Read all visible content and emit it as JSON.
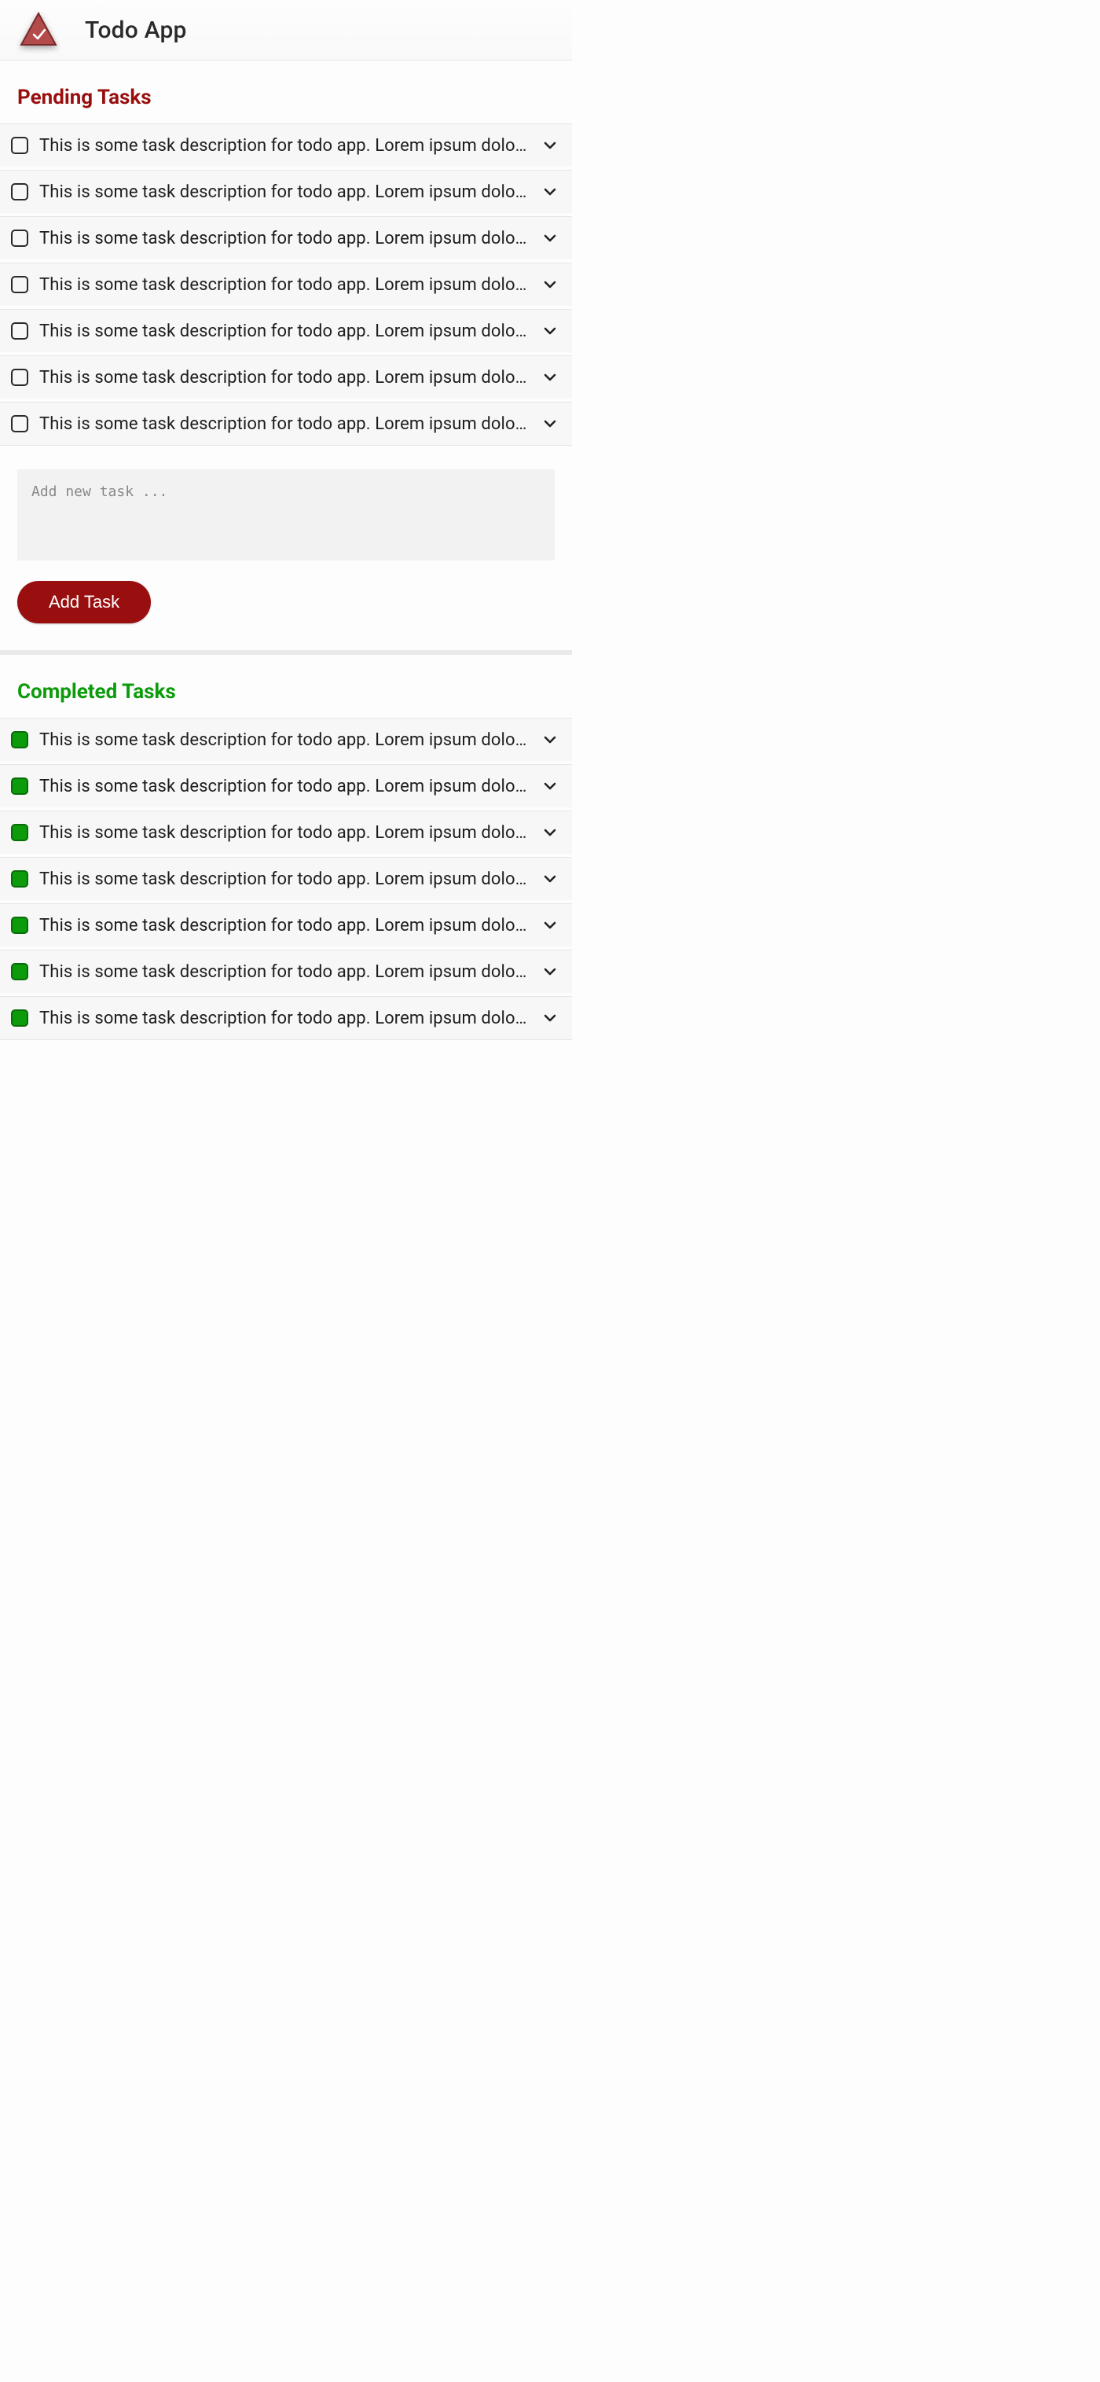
{
  "header": {
    "title": "Todo App",
    "logo_icon": "triangle-check-icon"
  },
  "pending": {
    "title": "Pending Tasks",
    "tasks": [
      {
        "text": "This is some task description for todo app. Lorem ipsum dolor sit amet."
      },
      {
        "text": "This is some task description for todo app. Lorem ipsum dolor sit amet."
      },
      {
        "text": "This is some task description for todo app. Lorem ipsum dolor sit amet."
      },
      {
        "text": "This is some task description for todo app. Lorem ipsum dolor sit amet."
      },
      {
        "text": "This is some task description for todo app. Lorem ipsum dolor sit amet."
      },
      {
        "text": "This is some task description for todo app. Lorem ipsum dolor sit amet."
      },
      {
        "text": "This is some task description for todo app. Lorem ipsum dolor sit amet."
      }
    ]
  },
  "add": {
    "placeholder": "Add new task ...",
    "button_label": "Add Task"
  },
  "completed": {
    "title": "Completed Tasks",
    "tasks": [
      {
        "text": "This is some task description for todo app. Lorem ipsum dolor sit amet."
      },
      {
        "text": "This is some task description for todo app. Lorem ipsum dolor sit amet."
      },
      {
        "text": "This is some task description for todo app. Lorem ipsum dolor sit amet."
      },
      {
        "text": "This is some task description for todo app. Lorem ipsum dolor sit amet."
      },
      {
        "text": "This is some task description for todo app. Lorem ipsum dolor sit amet."
      },
      {
        "text": "This is some task description for todo app. Lorem ipsum dolor sit amet."
      },
      {
        "text": "This is some task description for todo app. Lorem ipsum dolor sit amet."
      }
    ]
  },
  "colors": {
    "accent_pending": "#990f0f",
    "accent_completed": "#0b9b0b"
  }
}
